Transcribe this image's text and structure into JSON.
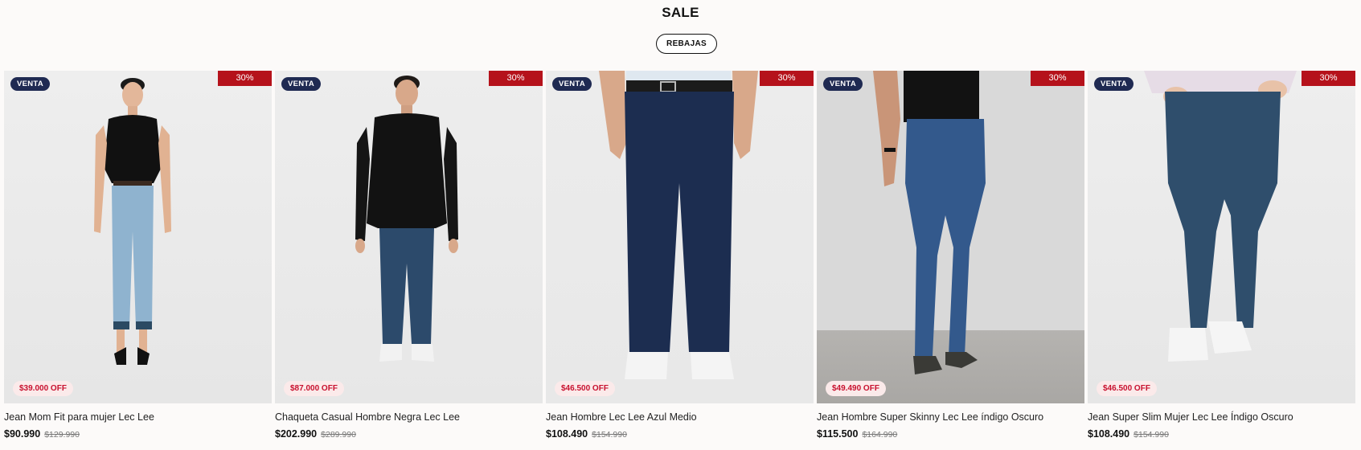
{
  "section": {
    "title": "SALE",
    "filter_button": "REBAJAS"
  },
  "products": [
    {
      "name": "Jean Mom Fit para mujer Lec Lee",
      "price": "$90.990",
      "old_price": "$129.990",
      "badge": "VENTA",
      "discount": "30%",
      "savings": "$39.000 OFF",
      "image_icon": "woman-black-top-light-jeans"
    },
    {
      "name": "Chaqueta Casual Hombre Negra Lec Lee",
      "price": "$202.990",
      "old_price": "$289.990",
      "badge": "VENTA",
      "discount": "30%",
      "savings": "$87.000 OFF",
      "image_icon": "man-black-jacket-jeans"
    },
    {
      "name": "Jean Hombre Lec Lee Azul Medio",
      "price": "$108.490",
      "old_price": "$154.990",
      "badge": "VENTA",
      "discount": "30%",
      "savings": "$46.500 OFF",
      "image_icon": "dark-straight-jeans-legs"
    },
    {
      "name": "Jean Hombre Super Skinny Lec Lee índigo Oscuro",
      "price": "$115.500",
      "old_price": "$164.990",
      "badge": "VENTA",
      "discount": "30%",
      "savings": "$49.490 OFF",
      "image_icon": "skinny-jeans-side-view"
    },
    {
      "name": "Jean Super Slim Mujer Lec Lee Índigo Oscuro",
      "price": "$108.490",
      "old_price": "$154.990",
      "badge": "VENTA",
      "discount": "30%",
      "savings": "$46.500 OFF",
      "image_icon": "slim-jeans-white-sneakers"
    }
  ],
  "colors": {
    "venta_badge": "#1f2a52",
    "discount_badge": "#b5121b",
    "savings_text": "#c8102e",
    "savings_bg": "#fbeaea"
  }
}
